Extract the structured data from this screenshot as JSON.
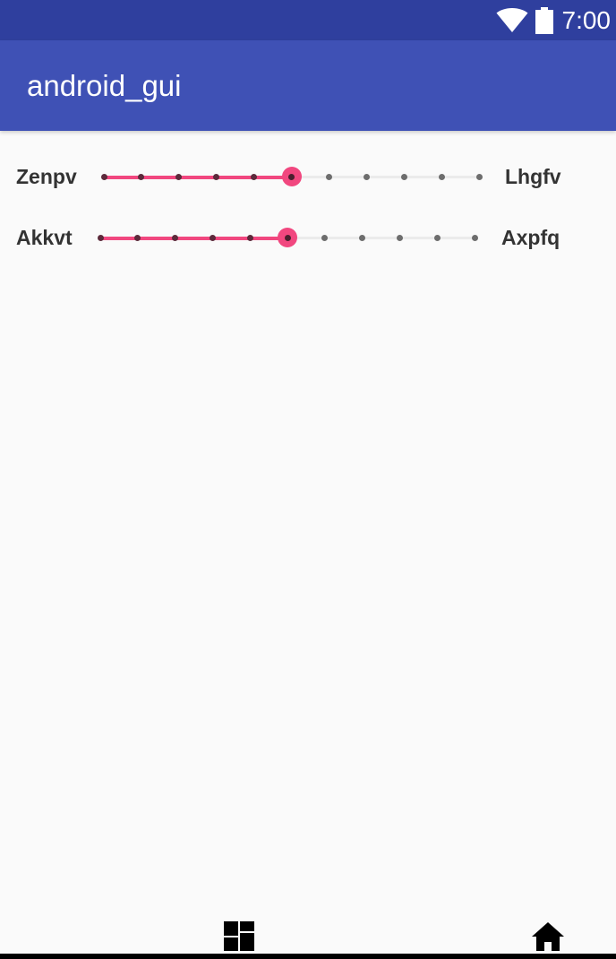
{
  "status_bar": {
    "time": "7:00",
    "icons": [
      "wifi-icon",
      "battery-icon"
    ],
    "color": "#2f3f9e"
  },
  "app_bar": {
    "title": "android_gui",
    "color": "#3f51b5"
  },
  "sliders": [
    {
      "left_label": "Zenpv",
      "right_label": "Lhgfv",
      "steps": 10,
      "value": 5
    },
    {
      "left_label": "Akkvt",
      "right_label": "Axpfq",
      "steps": 10,
      "value": 5
    }
  ],
  "accent_color": "#f1477f",
  "bottom_nav": {
    "items": [
      "dashboard-icon",
      "home-icon"
    ]
  }
}
